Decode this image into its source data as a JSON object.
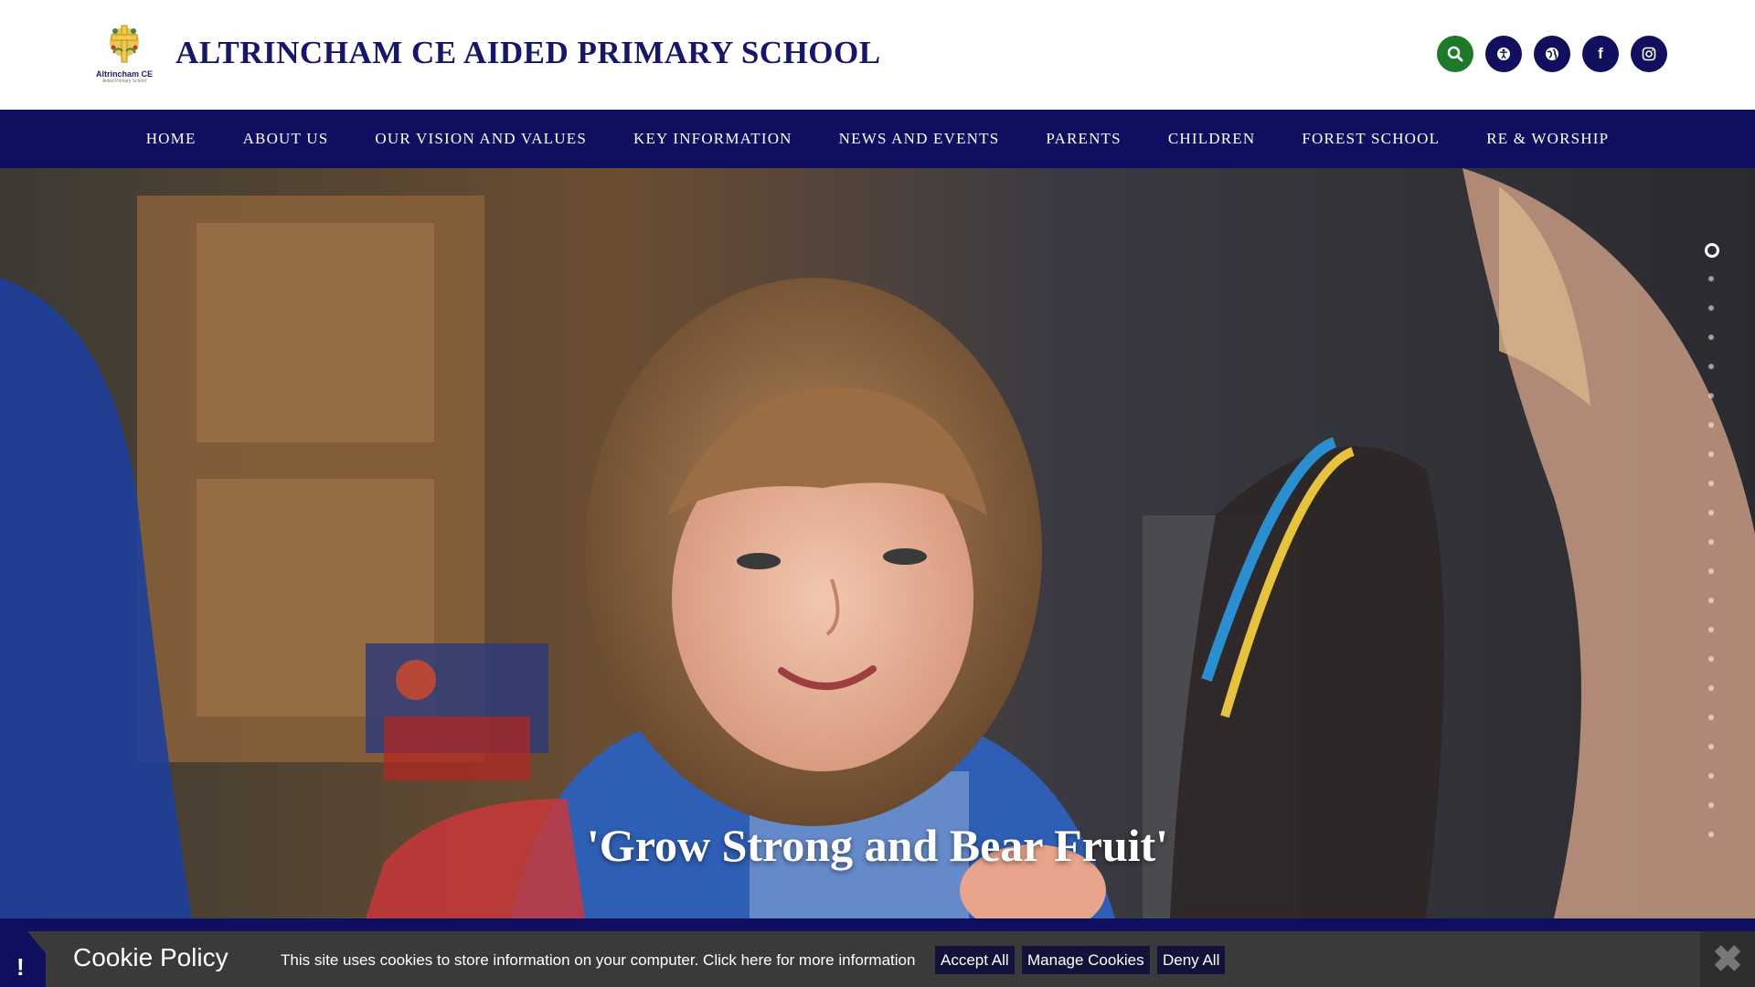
{
  "header": {
    "logo_text": "Altrincham CE",
    "logo_sub": "Aided Primary School",
    "title": "ALTRINCHAM CE AIDED PRIMARY SCHOOL",
    "icons": [
      {
        "name": "search-icon",
        "glyph": "⌕",
        "color": "#1e7a2a"
      },
      {
        "name": "accessibility-icon",
        "glyph": "♿",
        "color": "#10105e"
      },
      {
        "name": "translate-icon",
        "glyph": "◐",
        "color": "#10105e"
      },
      {
        "name": "facebook-icon",
        "glyph": "f",
        "color": "#10105e"
      },
      {
        "name": "instagram-icon",
        "glyph": "◎",
        "color": "#10105e"
      }
    ]
  },
  "nav": {
    "items": [
      "HOME",
      "ABOUT US",
      "OUR VISION AND VALUES",
      "KEY INFORMATION",
      "NEWS AND EVENTS",
      "PARENTS",
      "CHILDREN",
      "FOREST SCHOOL",
      "RE & WORSHIP"
    ]
  },
  "hero": {
    "caption": "'Grow Strong and Bear Fruit'",
    "slide_count": 21,
    "active_slide": 1
  },
  "cookie": {
    "alert_icon": "!",
    "title": "Cookie Policy",
    "text": "This site uses cookies to store information on your computer. Click here for more information",
    "accept_label": "Accept All",
    "manage_label": "Manage Cookies",
    "deny_label": "Deny All",
    "close_icon": "✖"
  },
  "colors": {
    "navy": "#0f0f62",
    "green": "#1e7a2a",
    "cookie_bg": "#3a3a3a"
  }
}
